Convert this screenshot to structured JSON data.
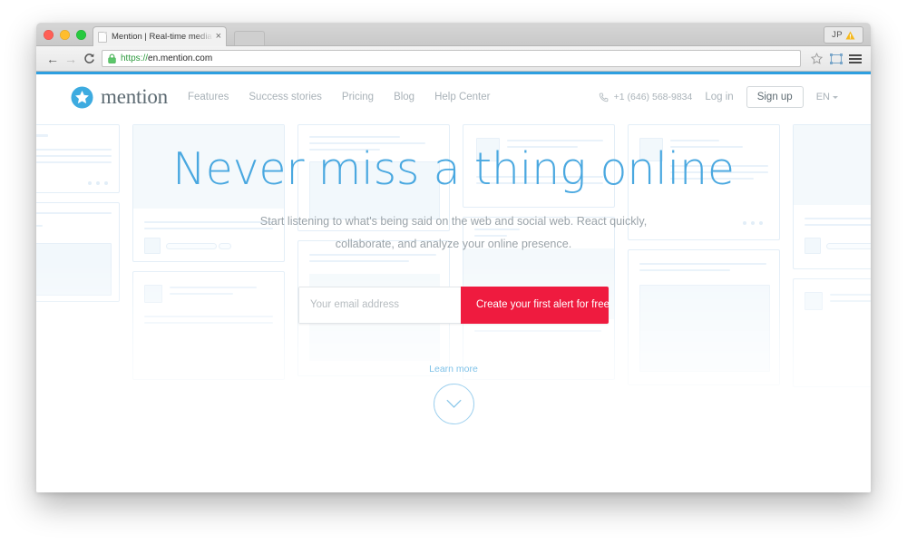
{
  "browser": {
    "tab": {
      "title": "Mention | Real-time media",
      "close_label": "×",
      "favicon": "page-icon"
    },
    "newtab_label": "",
    "profile": {
      "initials": "JP",
      "warning": "warning-triangle-icon"
    },
    "toolbar": {
      "back": "←",
      "forward": "→",
      "reload": "C",
      "url_scheme": "https://",
      "url_host": "en.mention.com",
      "lock": "lock-icon",
      "bookmark": "star-icon",
      "cast": "cast-icon",
      "menu": "hamburger-menu-icon"
    }
  },
  "site": {
    "brand": {
      "name": "mention",
      "mark": "star-badge-logo"
    },
    "nav": [
      {
        "label": "Features"
      },
      {
        "label": "Success stories"
      },
      {
        "label": "Pricing"
      },
      {
        "label": "Blog"
      },
      {
        "label": "Help Center"
      }
    ],
    "header_right": {
      "phone_icon": "phone-icon",
      "phone": "+1 (646) 568-9834",
      "login": "Log in",
      "signup": "Sign up",
      "language": "EN"
    },
    "hero": {
      "title": "Never miss a thing online",
      "subtitle": "Start listening to what's being said on the web and social web. React quickly, collaborate, and analyze your online presence.",
      "email_placeholder": "Your email address",
      "email_value": "",
      "cta": "Create your first alert for free",
      "learn_more": "Learn more",
      "scroll_icon": "chevron-down-icon"
    },
    "colors": {
      "accent_blue": "#4aa8e0",
      "cta_red": "#ef1b3f",
      "logo_blue": "#3dabe0",
      "muted_text": "#a9b2b8",
      "loadbar_blue": "#2e9fe0"
    }
  }
}
